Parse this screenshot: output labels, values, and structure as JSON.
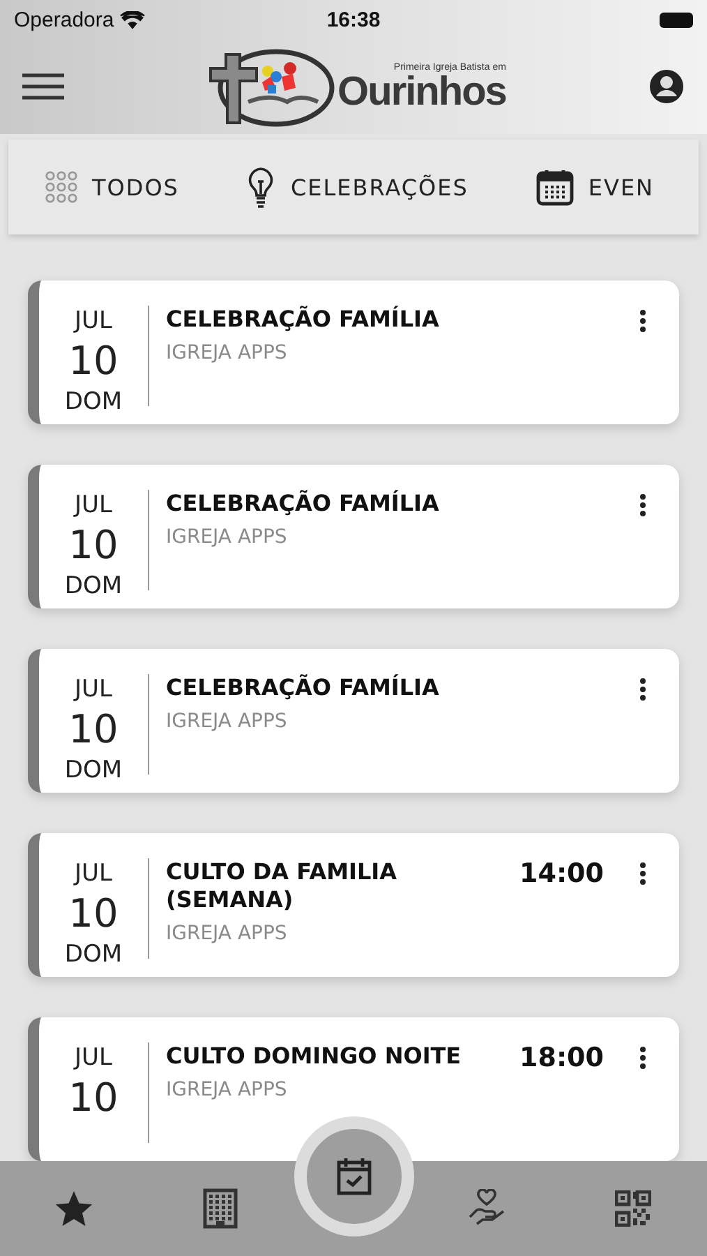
{
  "status_bar": {
    "carrier": "Operadora",
    "time": "16:38"
  },
  "header": {
    "logo_tagline": "Primeira Igreja Batista em",
    "logo_name": "Ourinhos"
  },
  "tabs": [
    {
      "label": "TODOS",
      "kind": "grid"
    },
    {
      "label": "CELEBRAÇÕES",
      "kind": "bulb"
    },
    {
      "label": "EVEN",
      "kind": "calendar"
    }
  ],
  "events": [
    {
      "month": "JUL",
      "day": "10",
      "weekday": "DOM",
      "title": "CELEBRAÇÃO FAMÍLIA",
      "organizer": "IGREJA APPS"
    },
    {
      "month": "JUL",
      "day": "10",
      "weekday": "DOM",
      "title": "CELEBRAÇÃO FAMÍLIA",
      "organizer": "IGREJA APPS"
    },
    {
      "month": "JUL",
      "day": "10",
      "weekday": "DOM",
      "title": "CELEBRAÇÃO FAMÍLIA",
      "organizer": "IGREJA APPS"
    },
    {
      "month": "JUL",
      "day": "10",
      "weekday": "DOM",
      "title": "CULTO DA FAMILIA (SEMANA)",
      "organizer": "IGREJA APPS",
      "time": "14:00"
    },
    {
      "month": "JUL",
      "day": "10",
      "title": "CULTO DOMINGO NOITE",
      "organizer": "IGREJA APPS",
      "time": "18:00"
    }
  ],
  "bottom_nav": [
    {
      "kind": "star",
      "selected": false
    },
    {
      "kind": "building",
      "selected": false
    },
    {
      "kind": "calendar",
      "selected": true
    },
    {
      "kind": "charity",
      "selected": false
    },
    {
      "kind": "qr",
      "selected": false
    }
  ]
}
